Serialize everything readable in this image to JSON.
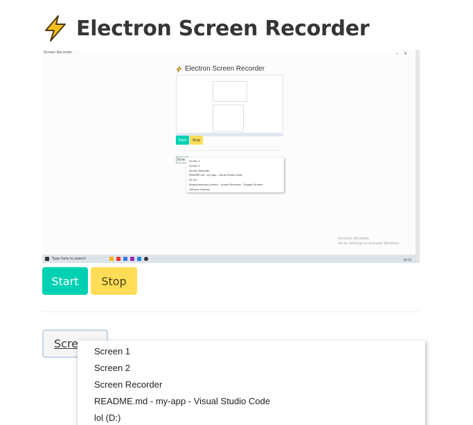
{
  "app": {
    "title": "Electron Screen Recorder",
    "title_icon": "lightning-bolt-icon"
  },
  "preview": {
    "window_label": "Screen Recorder",
    "inner_title": "Electron Screen Recorder",
    "inner_start": "Start",
    "inner_stop": "Stop",
    "inner_select": "Scre",
    "inner_sources": [
      "Screen 1",
      "Screen 2",
      "Screen Recorder",
      "README.md - my-app - Visual Studio Code",
      "lol (D:)",
      "ffmpeg-electron-screen - Screen Recorder - Google Chrome",
      "GeForce Overlay"
    ],
    "watermark_line1": "Activate Windows",
    "watermark_line2": "Go to Settings to activate Windows.",
    "taskbar_search": "Type here to search",
    "clock": "18:12"
  },
  "controls": {
    "start_label": "Start",
    "stop_label": "Stop"
  },
  "source_select": {
    "label": "Scree"
  },
  "dropdown": {
    "items": [
      "Screen 1",
      "Screen 2",
      "Screen Recorder",
      "README.md - my-app - Visual Studio Code",
      "lol (D:)"
    ]
  },
  "colors": {
    "start": "#00d1b2",
    "stop": "#ffdd57",
    "title_text": "#363636"
  }
}
